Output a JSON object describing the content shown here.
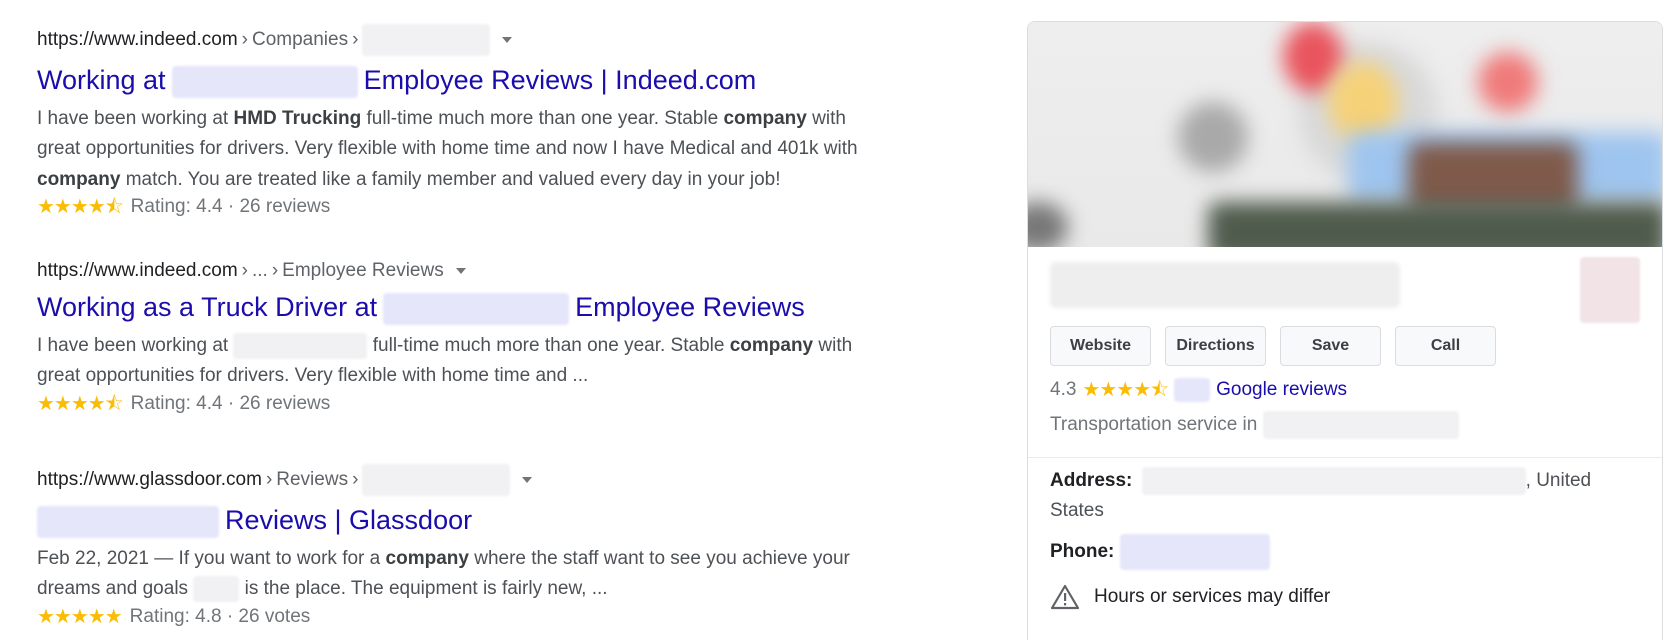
{
  "results": [
    {
      "url_host": "https://www.indeed.com",
      "crumbs": [
        "Companies"
      ],
      "title_before": "Working at",
      "title_after": "Employee Reviews | Indeed.com",
      "snippet": {
        "p1": "I have been working at ",
        "b1": "HMD Trucking",
        "p2": " full-time much more than one year. Stable ",
        "b2": "company",
        "p3": " with great opportunities for drivers. Very flexible with home time and now I have Medical and 401k with ",
        "b3": "company",
        "p4": " match. You are treated like a family member and valued every day in your job!"
      },
      "stars": "★★★★⯪",
      "rating_text": "Rating: 4.4 · 26 reviews"
    },
    {
      "url_host": "https://www.indeed.com",
      "crumbs": [
        "...",
        "Employee Reviews"
      ],
      "title_before": "Working as a Truck Driver at",
      "title_after": "Employee Reviews",
      "snippet": {
        "p1": "I have been working at ",
        "p2": " full-time much more than one year. Stable ",
        "b1": "company",
        "p3": " with great opportunities for drivers. Very flexible with home time and ..."
      },
      "stars": "★★★★⯪",
      "rating_text": "Rating: 4.4 · 26 reviews"
    },
    {
      "url_host": "https://www.glassdoor.com",
      "crumbs": [
        "Reviews"
      ],
      "title_after": "Reviews | Glassdoor",
      "snippet": {
        "p1": "Feb 22, 2021 — If you want to work for a ",
        "b1": "company",
        "p2": " where the staff want to see you achieve your dreams and goals ",
        "p3": " is the place. The equipment is fairly new, ..."
      },
      "stars": "★★★★★",
      "rating_text": "Rating: 4.8 · 26 votes"
    }
  ],
  "panel": {
    "buttons": {
      "website": "Website",
      "directions": "Directions",
      "save": "Save",
      "call": "Call"
    },
    "rating_score": "4.3",
    "stars": "★★★★⯪",
    "reviews_link": "Google reviews",
    "category": "Transportation service in",
    "address_label": "Address:",
    "address_tail": ", United States",
    "phone_label": "Phone:",
    "hours_notice": "Hours or services may differ"
  },
  "colors": {
    "link": "#1a0dab",
    "star": "#fbbc04",
    "text": "#4d5156"
  }
}
